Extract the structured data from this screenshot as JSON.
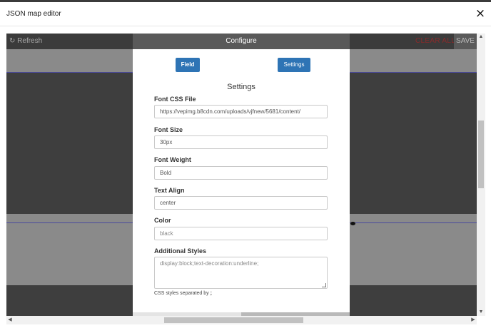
{
  "window": {
    "title": "JSON map editor",
    "close_icon": "×"
  },
  "toolbar": {
    "refresh_label": "↻ Refresh",
    "clear_label": "CLEAR ALL",
    "save_label": "SAVE"
  },
  "modal": {
    "title": "Configure",
    "field_button": "Field",
    "settings_button": "Settings",
    "heading": "Settings",
    "fields": [
      {
        "label": "Font CSS File",
        "value": "https://vepimg.b8cdn.com/uploads/vjfnew/5681/content/"
      },
      {
        "label": "Font Size",
        "value": "30px"
      },
      {
        "label": "Font Weight",
        "value": "Bold"
      },
      {
        "label": "Text Align",
        "value": "center"
      },
      {
        "label": "Color",
        "placeholder": "black"
      }
    ],
    "additional_styles": {
      "label": "Additional Styles",
      "placeholder": "display:block;text-decoration:underline;"
    },
    "help_text": "CSS styles separated by",
    "help_separator": ";"
  },
  "colors": {
    "primary_button": "#2e74b5",
    "modal_header": "#595959",
    "canvas_dark": "#3e3e3e",
    "guide_line": "#4a4a9c"
  }
}
